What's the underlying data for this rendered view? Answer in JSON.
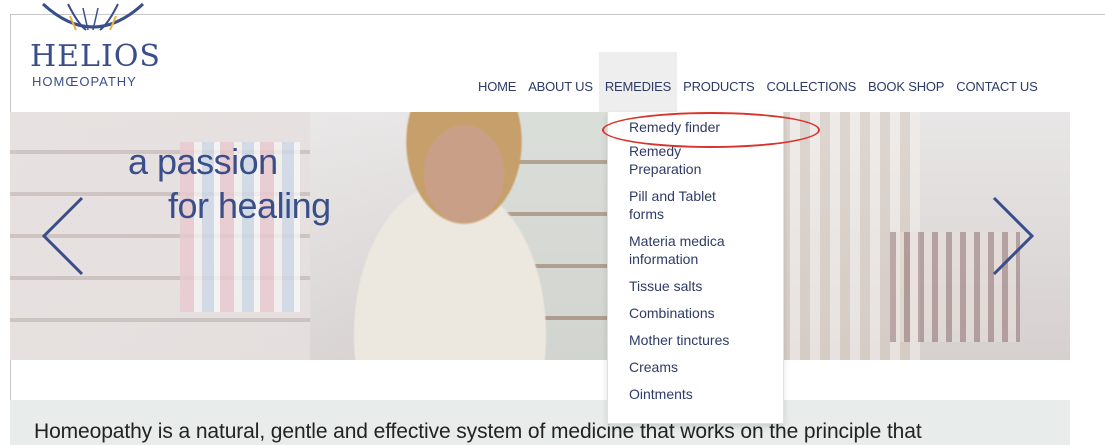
{
  "logo": {
    "wordmark": "HELIOS",
    "subline": "HOMŒOPATHY",
    "brand_color": "#3a4f8a"
  },
  "nav": {
    "items": [
      {
        "label": "HOME",
        "name": "nav-home"
      },
      {
        "label": "ABOUT US",
        "name": "nav-about-us"
      },
      {
        "label": "REMEDIES",
        "name": "nav-remedies",
        "active": true
      },
      {
        "label": "PRODUCTS",
        "name": "nav-products"
      },
      {
        "label": "COLLECTIONS",
        "name": "nav-collections"
      },
      {
        "label": "BOOK SHOP",
        "name": "nav-book-shop"
      },
      {
        "label": "CONTACT US",
        "name": "nav-contact-us"
      }
    ]
  },
  "dropdown": {
    "items": [
      "Remedy finder",
      "Remedy Preparation",
      "Pill and Tablet forms",
      "Materia medica information",
      "Tissue salts",
      "Combinations",
      "Mother tinctures",
      "Creams",
      "Ointments"
    ],
    "highlighted": "Remedy finder",
    "highlight_color": "#d9342b"
  },
  "hero": {
    "tagline_line1": "a passion",
    "tagline_line2": "for healing",
    "prev_icon": "chevron-left-icon",
    "next_icon": "chevron-right-icon"
  },
  "intro": {
    "text": "Homeopathy is a natural, gentle and effective system of medicine that works on the principle that"
  }
}
